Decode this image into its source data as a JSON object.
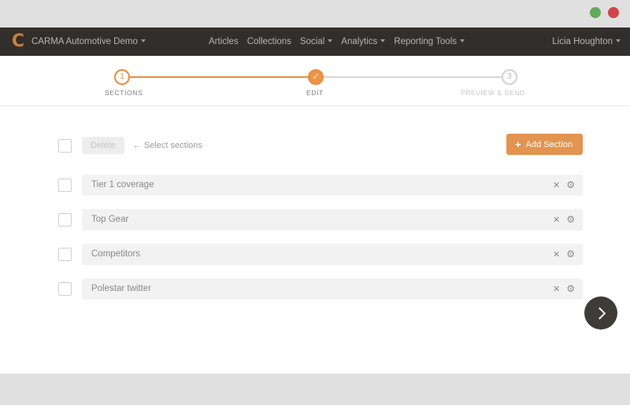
{
  "window": {
    "buttons": [
      {
        "name": "minimize",
        "color": "#62ab5c"
      },
      {
        "name": "close",
        "color": "#cf4444"
      }
    ]
  },
  "navbar": {
    "logo_glyph": "C",
    "logo_icon": "carma-logo-icon",
    "brand": "CARMA Automotive Demo",
    "brand_caret": "caret-down-icon",
    "links": [
      {
        "label": "Articles",
        "has_caret": false
      },
      {
        "label": "Collections",
        "has_caret": false
      },
      {
        "label": "Social",
        "has_caret": true
      },
      {
        "label": "Analytics",
        "has_caret": true
      },
      {
        "label": "Reporting Tools",
        "has_caret": true
      }
    ],
    "user": "Licia Houghton",
    "user_caret": "caret-down-icon"
  },
  "stepper": {
    "steps": [
      {
        "number": "1",
        "label": "SECTIONS",
        "state": "active"
      },
      {
        "number": "✓",
        "label": "EDIT",
        "state": "current"
      },
      {
        "number": "3",
        "label": "PREVIEW & SEND",
        "state": "future"
      }
    ],
    "accent_color": "#e98d3e",
    "inactive_color": "#d2d2d2"
  },
  "toolbar": {
    "select_all_checkbox": "unchecked",
    "delete_label": "Delete",
    "delete_enabled": false,
    "hint": "← Select sections",
    "add_section_label": "Add Section",
    "add_section_icon": "plus-icon",
    "add_section_color": "#e29450"
  },
  "sections": [
    {
      "title": "Tier 1 coverage",
      "checked": false,
      "remove_icon": "close-icon",
      "settings_icon": "gear-icon"
    },
    {
      "title": "Top Gear",
      "checked": false,
      "remove_icon": "close-icon",
      "settings_icon": "gear-icon"
    },
    {
      "title": "Competitors",
      "checked": false,
      "remove_icon": "close-icon",
      "settings_icon": "gear-icon"
    },
    {
      "title": "Polestar twitter",
      "checked": false,
      "remove_icon": "close-icon",
      "settings_icon": "gear-icon"
    }
  ],
  "icons": {
    "close": "✕",
    "gear": "⚙",
    "plus": "+"
  },
  "fab": {
    "icon": "chevron-right-icon",
    "color": "#3f3b38"
  }
}
